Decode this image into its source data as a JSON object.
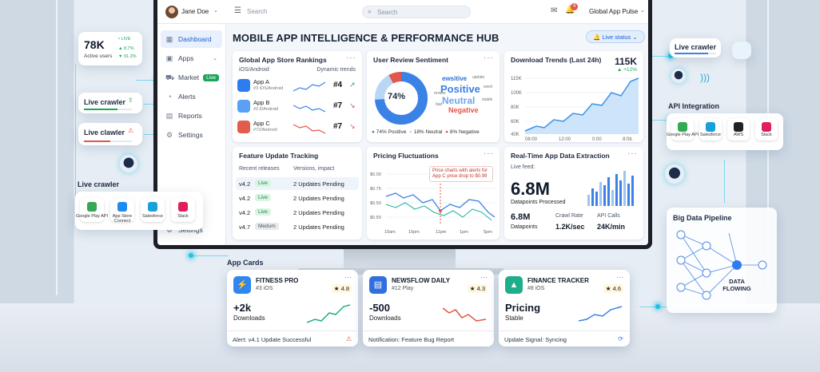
{
  "topbar": {
    "user_name": "Jane Doe",
    "search_left": "Search",
    "search_center": "Search",
    "notif_count": "4",
    "workspace": "Global App Pulse"
  },
  "sidebar": {
    "items": [
      {
        "label": "Dashboard",
        "icon": "grid-icon"
      },
      {
        "label": "Apps",
        "icon": "apps-icon"
      },
      {
        "label": "Market",
        "icon": "cart-icon",
        "badge": "Live"
      },
      {
        "label": "Alerts",
        "icon": "bell-icon"
      },
      {
        "label": "Reports",
        "icon": "reports-icon"
      },
      {
        "label": "Settings",
        "icon": "gear-icon"
      }
    ],
    "settings2": "Settings"
  },
  "header": {
    "title": "MOBILE APP INTELLIGENCE & PERFORMANCE HUB",
    "live_status": "Live status"
  },
  "rankings": {
    "title": "Global App Store Rankings",
    "sub_left": "iOS/Android",
    "sub_right": "Dynamic trends",
    "apps": [
      {
        "name": "App A",
        "rank_line": "#3 iOS/Android",
        "rank": "#4",
        "arrow": "↗",
        "color": "#2f7bf0"
      },
      {
        "name": "App B",
        "rank_line": "#2.6/Android",
        "rank": "#7",
        "arrow": "↘",
        "color": "#5aa0f5"
      },
      {
        "name": "App C",
        "rank_line": "#72/Android",
        "rank": "#7",
        "arrow": "↘",
        "color": "#e25b4b"
      }
    ]
  },
  "sentiment": {
    "title": "User Review Sentiment",
    "center": "74%",
    "words": [
      "ewsitive",
      "Positive",
      "Neutral",
      "Negative",
      "bad",
      "word",
      "review",
      "stable",
      "update"
    ],
    "legend": [
      "74% Positive",
      "18% Neutral",
      "8% Negative"
    ],
    "colors": [
      "#3b82e6",
      "#b9d7f5",
      "#e2564b"
    ]
  },
  "downloads": {
    "title": "Download Trends (Last 24h)",
    "value": "115K",
    "change": "▲ +12%",
    "yticks": [
      "115K",
      "100K",
      "80K",
      "60K",
      "40K"
    ],
    "xticks": [
      "08:00",
      "12:00",
      "0:00",
      "8:0b"
    ]
  },
  "features": {
    "title": "Feature Update Tracking",
    "col1": "Recent releases",
    "col2": "Versions, impact",
    "rows": [
      {
        "ver": "v4.2",
        "tag": "Live",
        "impact": "2 Updates Pending"
      },
      {
        "ver": "v4.2",
        "tag": "Live",
        "impact": "2 Updates Pending"
      },
      {
        "ver": "v4.2",
        "tag": "Live",
        "impact": "2 Updates Pending"
      },
      {
        "ver": "v4.7",
        "tag": "Medum",
        "impact": "2 Updates Pending"
      }
    ]
  },
  "pricing": {
    "title": "Pricing Fluctuations",
    "note": "Price charts with alerts for App C price drop to $0.99",
    "yticks": [
      "$0.00",
      "$0.75",
      "$0.50",
      "$0.59"
    ],
    "xticks": [
      "10am",
      "10pm",
      "11pm",
      "1pm",
      "5pm"
    ]
  },
  "extraction": {
    "title": "Real-Time App Data Extraction",
    "feed_label": "Live feed:",
    "big": "6.8M",
    "big_label": "Datapoints Processed",
    "small_val": "6.8M",
    "small_label": "Datapoints",
    "crawl_label": "Crawl Rate",
    "crawl_val": "1.2K/sec",
    "api_label": "API Calls",
    "api_val": "24K/min"
  },
  "left_float": {
    "users_value": "78K",
    "users_label": "Active users",
    "live": "• LIVE",
    "stat1": "▲ 8.7%",
    "stat2": "▼ 91.2%",
    "crawler1": "Live crawler",
    "crawler2": "Live clawler",
    "crawler3": "Live crawler"
  },
  "left_logos": [
    {
      "name": "Google Play API",
      "color": "#34a853"
    },
    {
      "name": "App Store Connect",
      "color": "#1f8af0"
    },
    {
      "name": "Salesforce",
      "color": "#17a0db"
    },
    {
      "name": "Slack",
      "color": "#e01e5a"
    }
  ],
  "right_float": {
    "crawler": "Live crawler",
    "api_title": "API Integration",
    "logos": [
      {
        "name": "Google Play API",
        "color": "#34a853"
      },
      {
        "name": "Salesforce",
        "color": "#17a0db"
      },
      {
        "name": "AWS",
        "color": "#222"
      },
      {
        "name": "Slack",
        "color": "#e01e5a"
      }
    ],
    "pipeline_title": "Big Data Pipeline",
    "pipeline_label": "DATA FLOWING"
  },
  "app_cards_label": "App Cards",
  "app_cards": [
    {
      "name": "FITNESS PRO",
      "rank": "#3 iOS",
      "rating": "★ 4.8",
      "metric": "+2k",
      "metric_label": "Downloads",
      "footer": "Alert: v4.1 Update Successful",
      "color": "#2f86f0"
    },
    {
      "name": "NEWSFLOW DAILY",
      "rank": "#12 Play",
      "rating": "★ 4.3",
      "metric": "-500",
      "metric_label": "Downloads",
      "footer": "Notification: Feature Bug Report",
      "color": "#2f6fe0"
    },
    {
      "name": "FINANCE TRACKER",
      "rank": "#8 iOS",
      "rating": "★ 4.6",
      "metric": "Pricing",
      "metric_label": "Stable",
      "footer": "Update Signal: Syncing",
      "color": "#1fae8a"
    }
  ],
  "colors": {
    "accent": "#2f7bf0",
    "positive": "#1ea55c",
    "negative": "#e2564b",
    "panel_bg": "#f3f6fa"
  }
}
